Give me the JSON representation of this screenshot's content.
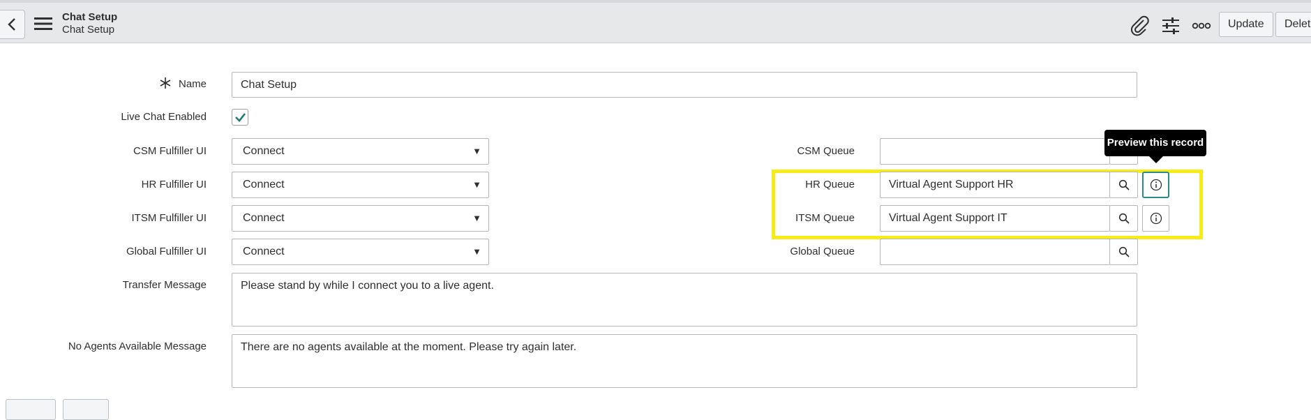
{
  "header": {
    "title": "Chat Setup",
    "subtitle": "Chat Setup",
    "update_label": "Update",
    "delete_label": "Delete"
  },
  "form": {
    "name": {
      "label": "Name",
      "value": "Chat Setup",
      "required": true
    },
    "live_chat": {
      "label": "Live Chat Enabled",
      "checked": true
    },
    "csm_fulfiller": {
      "label": "CSM Fulfiller UI",
      "value": "Connect"
    },
    "hr_fulfiller": {
      "label": "HR Fulfiller UI",
      "value": "Connect"
    },
    "itsm_fulfiller": {
      "label": "ITSM Fulfiller UI",
      "value": "Connect"
    },
    "global_fulfiller": {
      "label": "Global Fulfiller UI",
      "value": "Connect"
    },
    "csm_queue": {
      "label": "CSM Queue",
      "value": ""
    },
    "hr_queue": {
      "label": "HR Queue",
      "value": "Virtual Agent Support HR"
    },
    "itsm_queue": {
      "label": "ITSM Queue",
      "value": "Virtual Agent Support IT"
    },
    "global_queue": {
      "label": "Global Queue",
      "value": ""
    },
    "transfer_message": {
      "label": "Transfer Message",
      "value": "Please stand by while I connect you to a live agent."
    },
    "no_agents_message": {
      "label": "No Agents Available Message",
      "value": "There are no agents available at the moment.  Please try again later."
    }
  },
  "tooltip": {
    "text": "Preview this record"
  },
  "colors": {
    "header_bg": "#e6e8ea",
    "highlight": "#f7ec16",
    "checkmark": "#1f7a7a",
    "focus_border": "#2b8a8a"
  }
}
